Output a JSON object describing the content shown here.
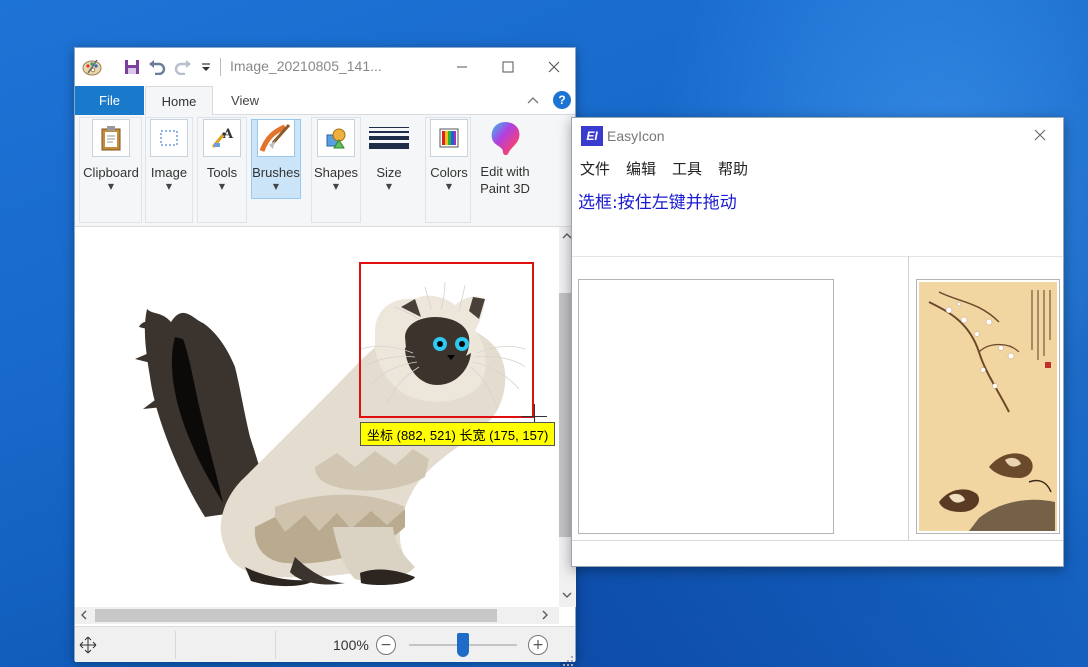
{
  "paint": {
    "title": "Image_20210805_141...",
    "tabs": {
      "file": "File",
      "home": "Home",
      "view": "View"
    },
    "help": "?",
    "ribbon": {
      "clipboard": "Clipboard",
      "image": "Image",
      "tools": "Tools",
      "brushes": "Brushes",
      "shapes": "Shapes",
      "size": "Size",
      "colors": "Colors",
      "edit_paint3d_line1": "Edit with",
      "edit_paint3d_line2": "Paint 3D"
    },
    "status": {
      "zoom": "100%",
      "zoom_fraction": 0.5
    },
    "selection_tooltip": "坐标 (882, 521) 长宽 (175, 157)"
  },
  "easyicon": {
    "title": "EasyIcon",
    "logo": "EI",
    "menu": [
      "文件",
      "编辑",
      "工具",
      "帮助"
    ],
    "status_text": "选框:按住左键并拖动"
  },
  "colors": {
    "file_tab": "#1979ca",
    "selection_rect": "#e01010",
    "tooltip_bg": "#ffff00",
    "ei_status_text": "#1a1ad0"
  },
  "icons": {
    "paint_app": "paint-palette-icon",
    "save": "save-icon",
    "undo": "undo-icon",
    "redo": "redo-icon",
    "customize": "customize-quick-access-icon",
    "minimize": "minimize-icon",
    "maximize": "maximize-icon",
    "close": "close-icon",
    "move": "move-icon"
  }
}
